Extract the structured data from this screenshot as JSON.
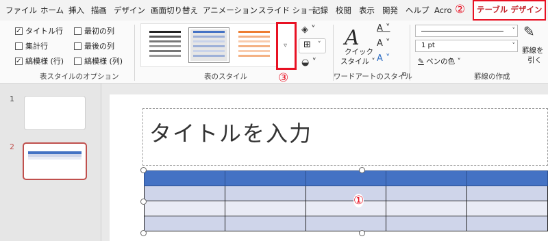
{
  "tabs": [
    "ファイル",
    "ホーム",
    "挿入",
    "描画",
    "デザイン",
    "画面切り替え",
    "アニメーション",
    "スライド ショー",
    "記録",
    "校閲",
    "表示",
    "開発",
    "ヘルプ",
    "Acro"
  ],
  "active_tab": "テーブル デザイン",
  "markers": {
    "m1": "①",
    "m2": "②",
    "m3": "③"
  },
  "options": {
    "header_row": "タイトル行",
    "first_col": "最初の列",
    "total_row": "集計行",
    "last_col": "最後の列",
    "banded_rows": "縞模様 (行)",
    "banded_cols": "縞模様 (列)",
    "group_label": "表スタイルのオプション"
  },
  "table_styles": {
    "group_label": "表のスタイル",
    "more_arrow": "▿"
  },
  "wordart": {
    "quick_style_line1": "クイック",
    "quick_style_line2": "スタイル ˅",
    "group_label": "ワードアートのスタイル"
  },
  "borders": {
    "pen_weight": "1 pt",
    "pen_color": "ペンの色 ˅",
    "draw_table_line1": "罫線を",
    "draw_table_line2": "引く",
    "group_label": "罫線の作成"
  },
  "slides": [
    {
      "num": "1"
    },
    {
      "num": "2"
    }
  ],
  "slide": {
    "title_placeholder": "タイトルを入力"
  },
  "colors": {
    "accent_red": "#e81123",
    "table_header": "#4472c4",
    "band_dark": "#cfd5ea",
    "band_light": "#e9ebf5"
  }
}
